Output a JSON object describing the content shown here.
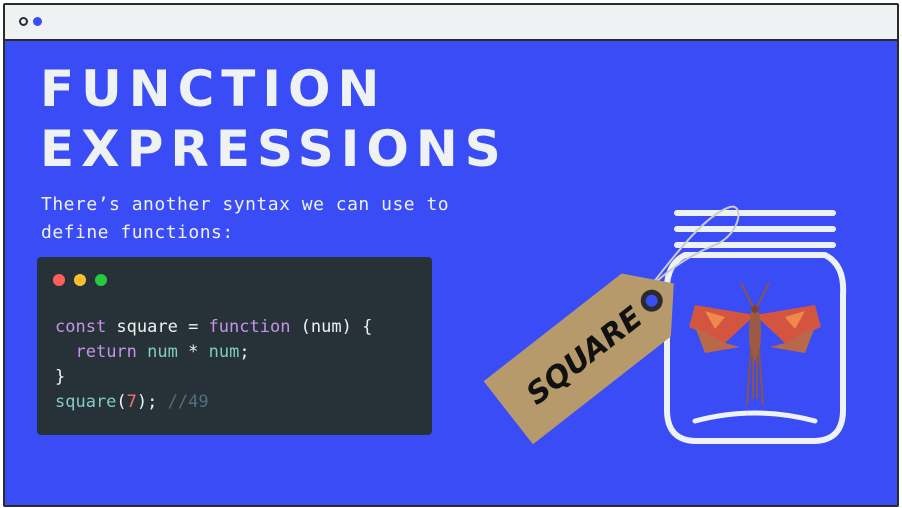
{
  "window": {
    "controls": [
      "window-dot-outline",
      "window-dot-filled"
    ]
  },
  "slide": {
    "title_line1": "FUNCTION",
    "title_line2": "EXPRESSIONS",
    "subtitle": "There’s another syntax we can use to define functions:"
  },
  "code": {
    "line1": {
      "kw1": "const",
      "p1": " square = ",
      "kw2": "function",
      "p2": " (num) {"
    },
    "line2": {
      "indent": "  ",
      "kw": "return",
      "sp": " ",
      "fn1": "num",
      "op": " * ",
      "fn2": "num",
      "end": ";"
    },
    "line3": "}",
    "line4": {
      "fn": "square",
      "open": "(",
      "arg": "7",
      "close": "); ",
      "comment": "//49"
    }
  },
  "tag": {
    "label": "SQUARE"
  },
  "colors": {
    "background": "#3a4cf6",
    "code_bg": "#263238",
    "keyword": "#c792ea",
    "function": "#80cbc4",
    "number": "#f07178",
    "comment": "#546e7a",
    "tag": "#b79a6b"
  }
}
